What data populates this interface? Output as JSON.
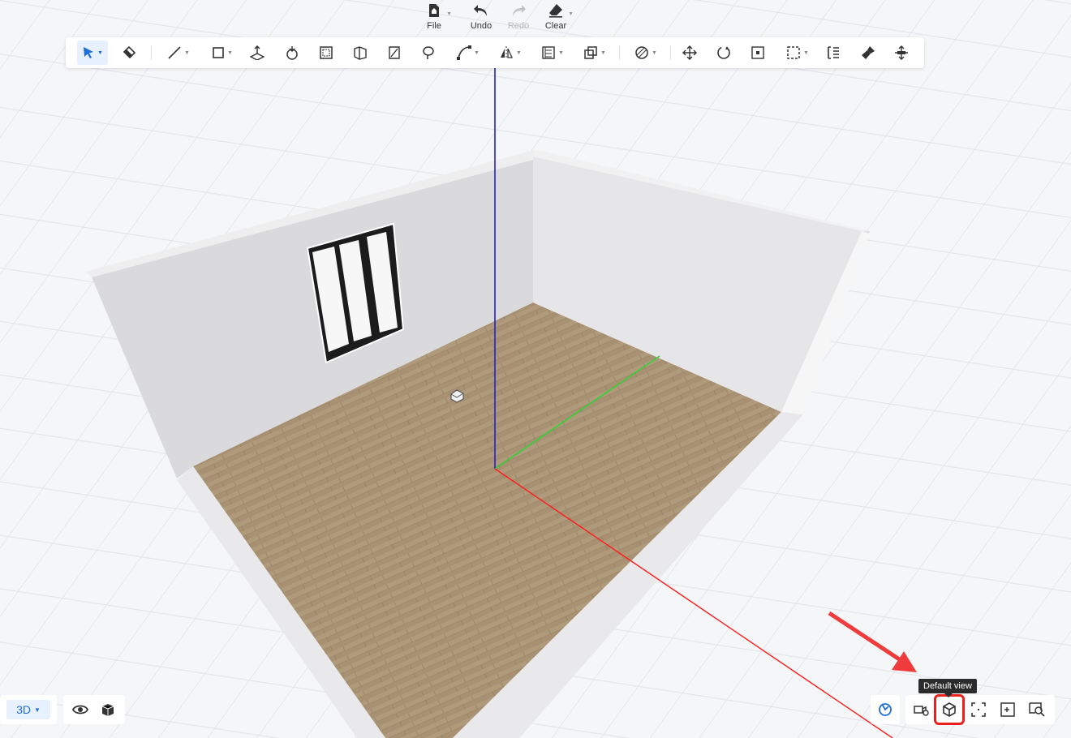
{
  "file_menu": {
    "file_label": "File",
    "undo_label": "Undo",
    "redo_label": "Redo",
    "clear_label": "Clear"
  },
  "toolbar": {
    "tools": [
      "select-tool",
      "paint-bucket-tool",
      "line-tool",
      "rectangle-tool",
      "push-pull-tool",
      "rotate-object-tool",
      "offset-tool",
      "box-tool",
      "cut-tool",
      "lasso-tool",
      "curve-tool",
      "mirror-tool",
      "align-tool",
      "duplicate-tool",
      "material-tool",
      "move-tool",
      "rotate-tool",
      "scale-tool",
      "select-area-tool",
      "distribute-tool",
      "clean-tool",
      "pan-tool"
    ]
  },
  "view_mode": {
    "label": "3D"
  },
  "tooltip": {
    "text": "Default view"
  },
  "colors": {
    "accent": "#1e6fd9",
    "highlight": "#ea1f1f",
    "axis_x": "#ff0000",
    "axis_y": "#22cc22",
    "axis_z": "#2222cc",
    "floor": "#a89173"
  },
  "bottom_right_tools": [
    "snap-toggle",
    "camera-settings",
    "default-view",
    "zoom-fit",
    "zoom-selection",
    "zoom-search"
  ]
}
